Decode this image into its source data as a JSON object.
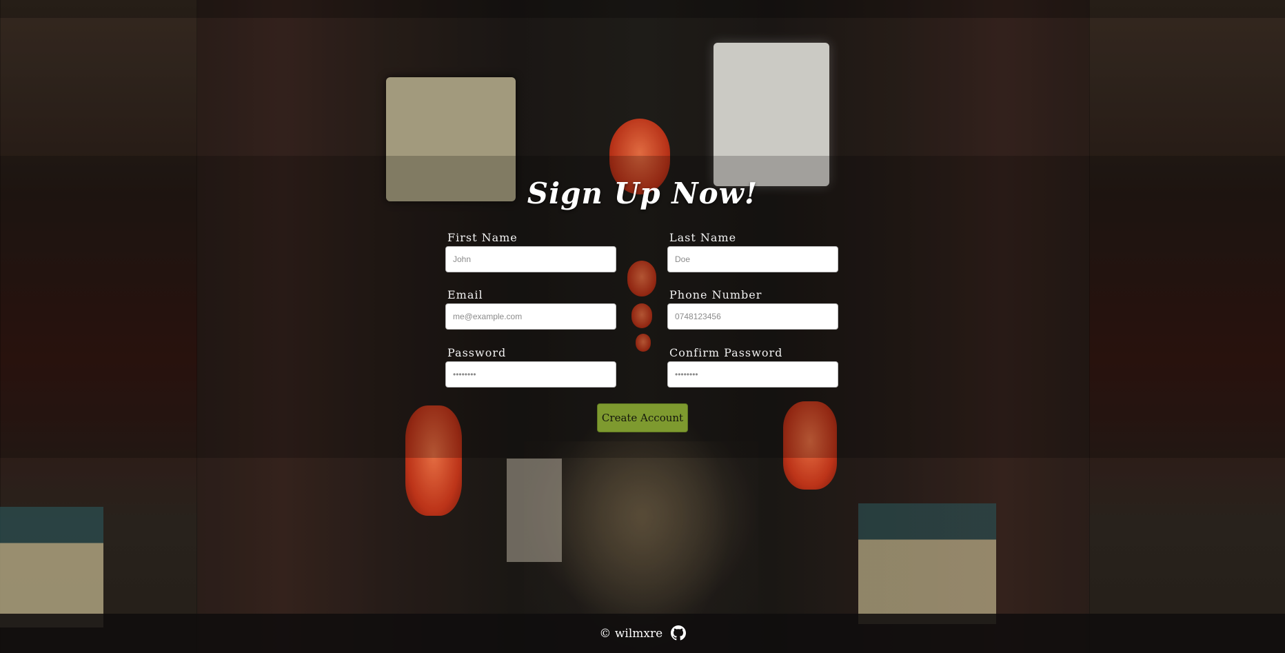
{
  "signup": {
    "title": "Sign Up Now!",
    "fields": {
      "first_name": {
        "label": "First Name",
        "placeholder": "John"
      },
      "last_name": {
        "label": "Last Name",
        "placeholder": "Doe"
      },
      "email": {
        "label": "Email",
        "placeholder": "me@example.com"
      },
      "phone": {
        "label": "Phone Number",
        "placeholder": "0748123456"
      },
      "password": {
        "label": "Password",
        "placeholder": "••••••••"
      },
      "confirm_password": {
        "label": "Confirm Password",
        "placeholder": "••••••••"
      }
    },
    "submit_label": "Create Account"
  },
  "footer": {
    "text": "© wilmxre",
    "icon": "github-icon"
  },
  "colors": {
    "button_bg": "#7e9a2f",
    "text": "#ffffff"
  }
}
